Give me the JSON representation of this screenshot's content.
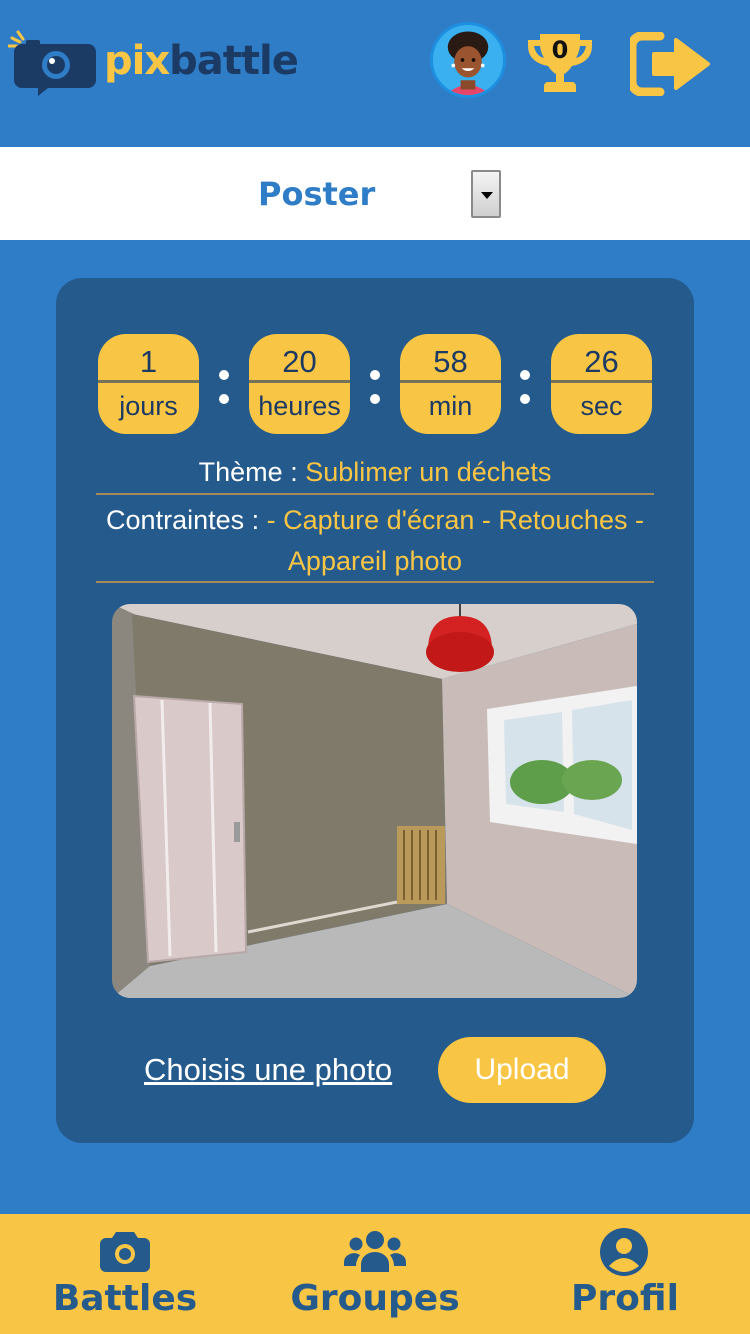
{
  "header": {
    "logo_part1": "pix",
    "logo_part2": "battle",
    "trophy_count": "0",
    "icons": [
      "camera-logo-icon",
      "avatar-icon",
      "trophy-icon",
      "logout-icon"
    ]
  },
  "select": {
    "value": "Poster"
  },
  "countdown": [
    {
      "value": "1",
      "unit": "jours"
    },
    {
      "value": "20",
      "unit": "heures"
    },
    {
      "value": "58",
      "unit": "min"
    },
    {
      "value": "26",
      "unit": "sec"
    }
  ],
  "theme": {
    "label": "Thème : ",
    "value": "Sublimer un déchets"
  },
  "constraints": {
    "label": "Contraintes : ",
    "value": "- Capture d'écran - Retouches - Appareil photo"
  },
  "actions": {
    "choose_label": "Choisis une photo",
    "upload_label": "Upload"
  },
  "nav": [
    {
      "label": "Battles",
      "icon": "camera-icon"
    },
    {
      "label": "Groupes",
      "icon": "users-icon"
    },
    {
      "label": "Profil",
      "icon": "user-circle-icon"
    }
  ],
  "colors": {
    "primary_blue": "#2f7cc7",
    "card_blue": "#245a8c",
    "accent_yellow": "#f9c545",
    "dark_navy": "#1b3a64"
  }
}
